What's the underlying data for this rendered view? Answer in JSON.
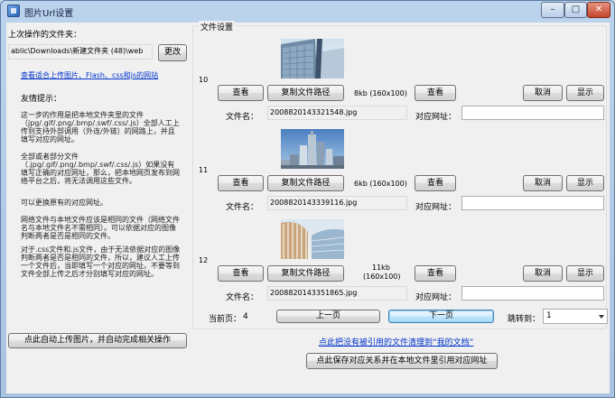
{
  "window": {
    "title": "图片Url设置",
    "controls": {
      "minimize": "–",
      "maximize": "□",
      "close": "✕"
    }
  },
  "left": {
    "last_folder_label": "上次操作的文件夹：",
    "folder_path": "ablic\\Downloads\\新建文件夹 (48)\\web",
    "change_button": "更改",
    "site_link": "查看适合上传图片、Flash、css和js的网站",
    "tips_title": "友情提示：",
    "tips": [
      "这一步的作用是把本地文件夹里的文件（jpg/.gif/.png/.bmp/.swf/.css/.js）全部人工上传到支持外部调用（外连/外链）的网路上，并且填写对应的网址。",
      "全部或者部分文件（.jpg/.gif/.png/.bmp/.swf/.css/.js）如果没有填写正确的对应网址，那么，把本地网页发布到网络平台之后，将无法调用这些文件。",
      "可以更换原有的对应网址。",
      "网络文件与本地文件应该是相同的文件（网络文件名与本地文件名不需相同）。可以依据对应的图像判断两者是否是相同的文件。",
      "对于.css文件和.js文件，由于无法依据对应的图像判断两者是否是相同的文件，所以，建议人工上传一个文件后，当即填写一个对应的网址。不要等到文件全部上传之后才分别填写对应的网址。"
    ],
    "auto_upload_button": "点此自动上传图片，并自动完成相关操作"
  },
  "group": {
    "title": "文件设置",
    "slots": [
      {
        "index": "10",
        "view_local": "查看",
        "copy_path": "复制文件路径",
        "size": "8kb (160x100)",
        "view_remote": "查看",
        "cancel": "取消",
        "show": "显示",
        "filename_label": "文件名：",
        "filename": "2008820143321548.jpg",
        "url_label": "对应网址：",
        "url": ""
      },
      {
        "index": "11",
        "view_local": "查看",
        "copy_path": "复制文件路径",
        "size": "6kb (160x100)",
        "view_remote": "查看",
        "cancel": "取消",
        "show": "显示",
        "filename_label": "文件名：",
        "filename": "2008820143339116.jpg",
        "url_label": "对应网址：",
        "url": ""
      },
      {
        "index": "12",
        "view_local": "查看",
        "copy_path": "复制文件路径",
        "size_line1": "11kb",
        "size_line2": "(160x100)",
        "view_remote": "查看",
        "cancel": "取消",
        "show": "显示",
        "filename_label": "文件名：",
        "filename": "2008820143351865.jpg",
        "url_label": "对应网址：",
        "url": ""
      }
    ],
    "current_page_label": "当前页：",
    "current_page": "4",
    "prev_button": "上一页",
    "next_button": "下一页",
    "goto_label": "跳转到：",
    "goto_value": "1"
  },
  "footer": {
    "cleanup_link": "点此把没有被引用的文件清理到“我的文档”",
    "save_button": "点此保存对应关系并在本地文件里引用对应网址"
  },
  "icons": {
    "app": "app-icon",
    "dropdown": "chevron-down-icon"
  },
  "colors": {
    "link": "#0033cc",
    "titlebar": "#bcd3ec",
    "client": "#f0f0f0"
  }
}
